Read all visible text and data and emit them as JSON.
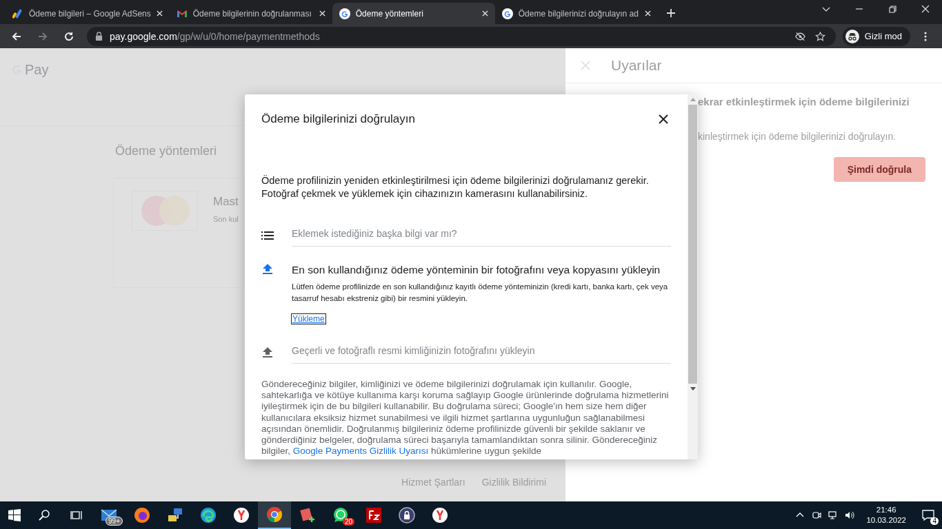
{
  "tabs": [
    {
      "title": "Ödeme bilgileri – Google AdSens",
      "kind": "adsense",
      "selected": false
    },
    {
      "title": "Ödeme bilgilerinin doğrulanması",
      "kind": "gmail",
      "selected": false
    },
    {
      "title": "Ödeme yöntemleri",
      "kind": "google",
      "selected": true
    },
    {
      "title": "Ödeme bilgilerinizi doğrulayın ad",
      "kind": "google",
      "selected": false
    }
  ],
  "address_bar": {
    "host": "pay.google.com",
    "path": "/gp/w/u/0/home/paymentmethods"
  },
  "profile": {
    "label": "Gizli mod"
  },
  "page": {
    "logo": "Pay",
    "heading": "Ödeme yöntemleri",
    "card_name": "Mast",
    "card_note": "Son kul",
    "footer_links": [
      "Hizmet Şartları",
      "Gizlilik Bildirimi"
    ]
  },
  "alerts_panel": {
    "title": "Uyarılar",
    "heading": "ekrar etkinleştirmek için ödeme bilgilerinizi",
    "text": "kinleştirmek için ödeme bilgilerinizi doğrulayın.",
    "button": "Şimdi doğrula"
  },
  "dialog": {
    "title": "Ödeme bilgilerinizi doğrulayın",
    "intro": "Ödeme profilinizin yeniden etkinleştirilmesi için ödeme bilgilerinizi doğrulamanız gerekir. Fotoğraf çekmek ve yüklemek için cihazınızın kamerasını kullanabilirsiniz.",
    "steps": [
      {
        "kind": "note",
        "title": "Eklemek istediğiniz başka bilgi var mı?",
        "expanded": false
      },
      {
        "kind": "upload",
        "title": "En son kullandığınız ödeme yönteminin bir fotoğrafını veya kopyasını yükleyin",
        "expanded": true,
        "description": "Lütfen ödeme profilinizde en son kullandığınız kayıtlı ödeme yönteminizin (kredi kartı, banka kartı, çek veya tasarruf hesabı ekstreniz gibi) bir resmini yükleyin.",
        "link": "Yükleme"
      },
      {
        "kind": "upload",
        "title": "Geçerli ve fotoğraflı resmi kimliğinizin fotoğrafını yükleyin",
        "expanded": false
      }
    ],
    "footer_text": "Göndereceğiniz bilgiler, kimliğinizi ve ödeme bilgilerinizi doğrulamak için kullanılır. Google, sahtekarlığa ve kötüye kullanıma karşı koruma sağlayıp Google ürünlerinde doğrulama hizmetlerini iyileştirmek için de bu bilgileri kullanabilir. Bu doğrulama süreci; Google'ın hem size hem diğer kullanıcılara eksiksiz hizmet sunabilmesi ve ilgili hizmet şartlarına uygunluğun sağlanabilmesi açısından önemlidir. Doğrulanmış bilgileriniz ödeme profilinizde güvenli bir şekilde saklanır ve gönderdiğiniz belgeler, doğrulama süreci başarıyla tamamlandıktan sonra silinir. Göndereceğiniz bilgiler,",
    "footer_link": "Google Payments Gizlilik Uyarısı",
    "footer_tail": "hükümlerine uygun şekilde"
  },
  "taskbar": {
    "apps": [
      {
        "kind": "mail",
        "badge": "99+",
        "selected": false
      },
      {
        "kind": "firefox",
        "selected": false
      },
      {
        "kind": "network",
        "selected": false
      },
      {
        "kind": "edge",
        "selected": false
      },
      {
        "kind": "yandex",
        "selected": false
      },
      {
        "kind": "chrome",
        "selected": true
      },
      {
        "kind": "notes",
        "selected": false
      },
      {
        "kind": "whatsapp",
        "badge": "20",
        "selected": false
      },
      {
        "kind": "filezilla",
        "selected": false
      },
      {
        "kind": "vpn",
        "selected": false
      },
      {
        "kind": "yandex",
        "selected": false
      }
    ],
    "time": "21:46",
    "date": "10.03.2022",
    "notifications": "4"
  }
}
